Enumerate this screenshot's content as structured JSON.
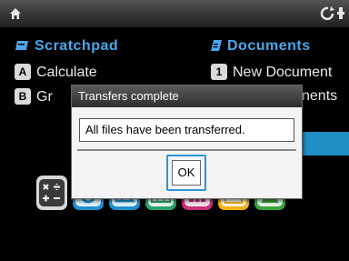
{
  "topbar": {
    "home_icon": "home-icon",
    "right_icon": "refresh-settings-icon"
  },
  "menu": {
    "scratchpad": {
      "title": "Scratchpad",
      "icon": "scratchpad-icon",
      "items": [
        {
          "key": "A",
          "label": "Calculate"
        },
        {
          "key": "B",
          "label": "Gr"
        }
      ]
    },
    "documents": {
      "title": "Documents",
      "icon": "documents-icon",
      "items": [
        {
          "key": "1",
          "label": "New Document"
        },
        {
          "key": "",
          "label": "nents"
        }
      ]
    }
  },
  "dialog": {
    "title": "Transfers complete",
    "message": "All files have been transferred.",
    "ok_label": "OK"
  },
  "dock": {
    "apps": [
      "calculator-icon",
      "graphs-icon",
      "geometry-icon",
      "lists-spreadsheet-icon",
      "data-statistics-icon",
      "notes-icon",
      "vernier-dataquest-icon"
    ]
  },
  "colors": {
    "accent": "#4aa8ea",
    "highlight": "#1f8fc6"
  }
}
